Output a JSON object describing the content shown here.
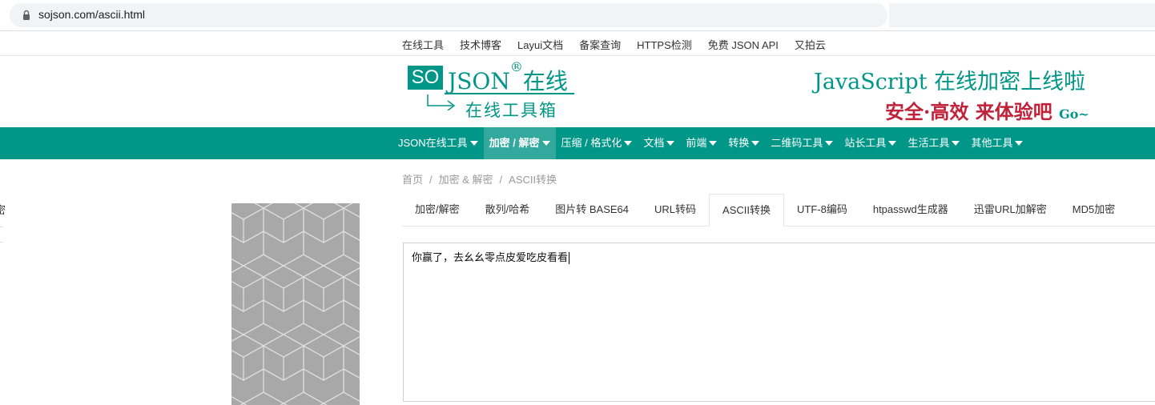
{
  "browser": {
    "url": "sojson.com/ascii.html"
  },
  "top_links": [
    "在线工具",
    "技术博客",
    "Layui文档",
    "备案查询",
    "HTTPS检测",
    "免费 JSON API",
    "又拍云"
  ],
  "logo": {
    "so": "SO",
    "json": "JSON",
    "reg": "®",
    "suffix": "在线",
    "subtitle": "在线工具箱"
  },
  "banner": {
    "line1": "JavaScript 在线加密上线啦",
    "line2": "安全·高效 来体验吧",
    "go": "Go~"
  },
  "main_nav": [
    {
      "label": "JSON在线工具",
      "active": false
    },
    {
      "label": "加密 / 解密",
      "active": true
    },
    {
      "label": "压缩 / 格式化",
      "active": false
    },
    {
      "label": "文档",
      "active": false
    },
    {
      "label": "前端",
      "active": false
    },
    {
      "label": "转换",
      "active": false
    },
    {
      "label": "二维码工具",
      "active": false
    },
    {
      "label": "站长工具",
      "active": false
    },
    {
      "label": "生活工具",
      "active": false
    },
    {
      "label": "其他工具",
      "active": false
    }
  ],
  "breadcrumb": {
    "items": [
      "首页",
      "加密 & 解密",
      "ASCII转换"
    ],
    "separator": "/"
  },
  "left_fragment": "密",
  "tabs": [
    {
      "label": "加密/解密",
      "active": false
    },
    {
      "label": "散列/哈希",
      "active": false
    },
    {
      "label": "图片转 BASE64",
      "active": false
    },
    {
      "label": "URL转码",
      "active": false
    },
    {
      "label": "ASCII转换",
      "active": true
    },
    {
      "label": "UTF-8编码",
      "active": false
    },
    {
      "label": "htpasswd生成器",
      "active": false
    },
    {
      "label": "迅雷URL加解密",
      "active": false
    },
    {
      "label": "MD5加密",
      "active": false
    }
  ],
  "editor": {
    "value": "你赢了，去幺幺零点皮爱吃皮看看"
  },
  "colors": {
    "brand": "#009688",
    "nav_active": "#33a89d",
    "banner_red": "#c0223a"
  }
}
